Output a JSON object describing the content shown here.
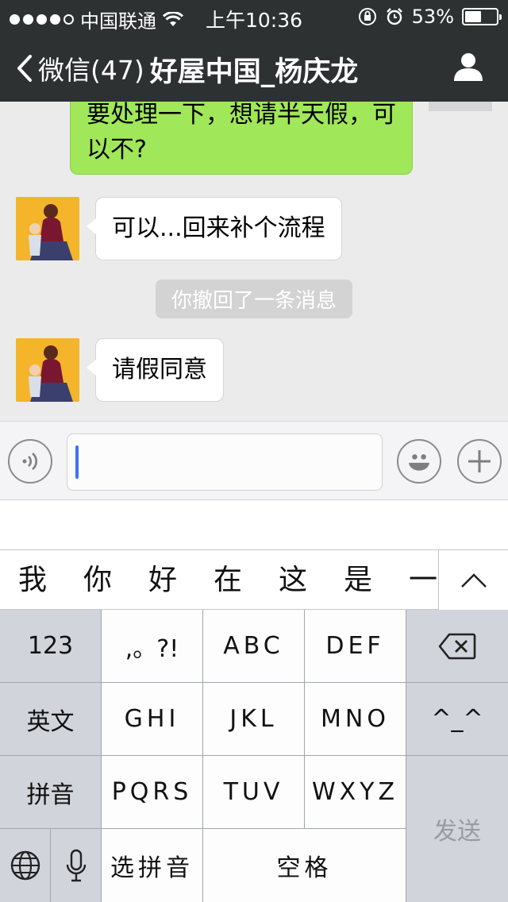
{
  "status": {
    "carrier": "中国联通",
    "time": "上午10:36",
    "battery": "53%",
    "battery_level": 0.53
  },
  "nav": {
    "back_label": "微信(47)",
    "title": "好屋中国_杨庆龙"
  },
  "messages": {
    "sent_1": "要处理一下，想请半天假，可以不?",
    "recv_1": "可以...回来补个流程",
    "system": "你撤回了一条消息",
    "recv_2": "请假同意"
  },
  "candidates": [
    "我",
    "你",
    "好",
    "在",
    "这",
    "是",
    "一"
  ],
  "keyboard": {
    "row1": [
      "123",
      ",。?!",
      "ABC",
      "DEF"
    ],
    "row2": [
      "英文",
      "GHI",
      "JKL",
      "MNO",
      "^_^"
    ],
    "row3": [
      "拼音",
      "PQRS",
      "TUV",
      "WXYZ"
    ],
    "send": "发送",
    "pinyin_select": "选拼音",
    "space": "空格"
  },
  "colors": {
    "header_bg": "#2e3132",
    "sent_bubble": "#a0e75a",
    "caret": "#3b74f5"
  }
}
